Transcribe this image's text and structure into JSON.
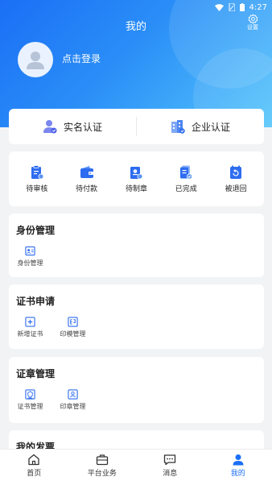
{
  "status_bar": {
    "time": "4:27"
  },
  "header": {
    "title": "我的",
    "settings_label": "设置"
  },
  "user": {
    "login_prompt": "点击登录"
  },
  "verification": [
    {
      "label": "实名认证",
      "icon": "person-verify-icon"
    },
    {
      "label": "企业认证",
      "icon": "building-verify-icon"
    }
  ],
  "orders": [
    {
      "label": "待审核",
      "icon": "pending-review-icon"
    },
    {
      "label": "待付款",
      "icon": "wallet-icon"
    },
    {
      "label": "待制章",
      "icon": "seal-pending-icon"
    },
    {
      "label": "已完成",
      "icon": "completed-icon"
    },
    {
      "label": "被退回",
      "icon": "returned-icon"
    }
  ],
  "sections": {
    "identity": {
      "title": "身份管理",
      "items": [
        {
          "label": "身份管理",
          "icon": "id-card-icon"
        }
      ]
    },
    "certificate": {
      "title": "证书申请",
      "items": [
        {
          "label": "新增证书",
          "icon": "add-certificate-icon"
        },
        {
          "label": "印模管理",
          "icon": "stamp-mold-icon"
        }
      ]
    },
    "seal": {
      "title": "证章管理",
      "items": [
        {
          "label": "证书管理",
          "icon": "certificate-manage-icon"
        },
        {
          "label": "印章管理",
          "icon": "seal-manage-icon"
        }
      ]
    },
    "invoice": {
      "title": "我的发票"
    }
  },
  "bottom_nav": [
    {
      "label": "首页",
      "icon": "home-icon",
      "active": false
    },
    {
      "label": "平台业务",
      "icon": "briefcase-icon",
      "active": false
    },
    {
      "label": "消息",
      "icon": "message-icon",
      "active": false
    },
    {
      "label": "我的",
      "icon": "user-icon",
      "active": true
    }
  ],
  "colors": {
    "primary": "#1b6ff5",
    "gradient_end": "#56c6fb",
    "background": "#f2f3f5"
  }
}
